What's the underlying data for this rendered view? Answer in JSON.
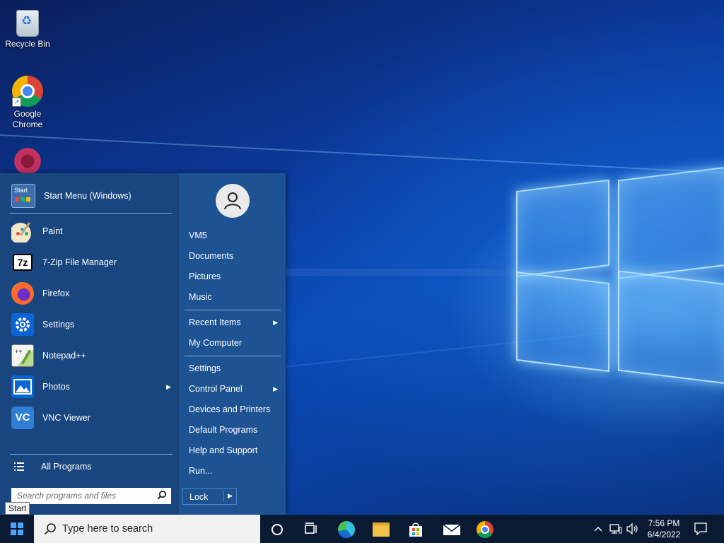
{
  "desktop": {
    "icons": [
      {
        "label": "Recycle Bin",
        "icon": "recycle-bin-icon"
      },
      {
        "label": "Google\nChrome",
        "icon": "chrome-icon"
      },
      {
        "label": "",
        "icon": "app-shortcut-icon"
      }
    ]
  },
  "start_menu": {
    "header_item": {
      "label": "Start Menu (Windows)",
      "icon": "start-menu-icon",
      "icon_text": "Start"
    },
    "pinned": [
      {
        "label": "Paint",
        "icon": "paint-icon"
      },
      {
        "label": "7-Zip File Manager",
        "icon": "7zip-icon",
        "icon_text": "7z"
      },
      {
        "label": "Firefox",
        "icon": "firefox-icon"
      },
      {
        "label": "Settings",
        "icon": "settings-gear-icon"
      },
      {
        "label": "Notepad++",
        "icon": "notepadpp-icon"
      },
      {
        "label": "Photos",
        "icon": "photos-icon",
        "has_submenu": true
      },
      {
        "label": "VNC Viewer",
        "icon": "vnc-viewer-icon",
        "icon_text": "VC"
      }
    ],
    "all_programs": "All Programs",
    "search_placeholder": "Search programs and files",
    "right": {
      "user_group": [
        "VM5",
        "Documents",
        "Pictures",
        "Music"
      ],
      "recent_group": [
        {
          "label": "Recent Items",
          "has_submenu": true
        },
        {
          "label": "My Computer",
          "has_submenu": false
        }
      ],
      "system_group": [
        {
          "label": "Settings",
          "has_submenu": false
        },
        {
          "label": "Control Panel",
          "has_submenu": true
        },
        {
          "label": "Devices and Printers",
          "has_submenu": false
        },
        {
          "label": "Default Programs",
          "has_submenu": false
        },
        {
          "label": "Help and Support",
          "has_submenu": false
        },
        {
          "label": "Run...",
          "has_submenu": false
        }
      ]
    },
    "lock_label": "Lock",
    "arrow_glyph": "▶"
  },
  "tooltip": "Start",
  "taskbar": {
    "search_placeholder": "Type here to search",
    "pinned_icons": [
      "cortana-icon",
      "task-view-icon",
      "edge-icon",
      "file-explorer-icon",
      "store-icon",
      "mail-icon",
      "chrome-icon"
    ],
    "tray_icons": [
      "chevron-up-icon",
      "network-icon",
      "volume-icon"
    ],
    "time": "7:56 PM",
    "date": "6/4/2022"
  },
  "colors": {
    "menu_left": "#19467e",
    "menu_right": "#1e5393",
    "taskbar": "#0b1a33",
    "accent": "#0a64d6"
  }
}
